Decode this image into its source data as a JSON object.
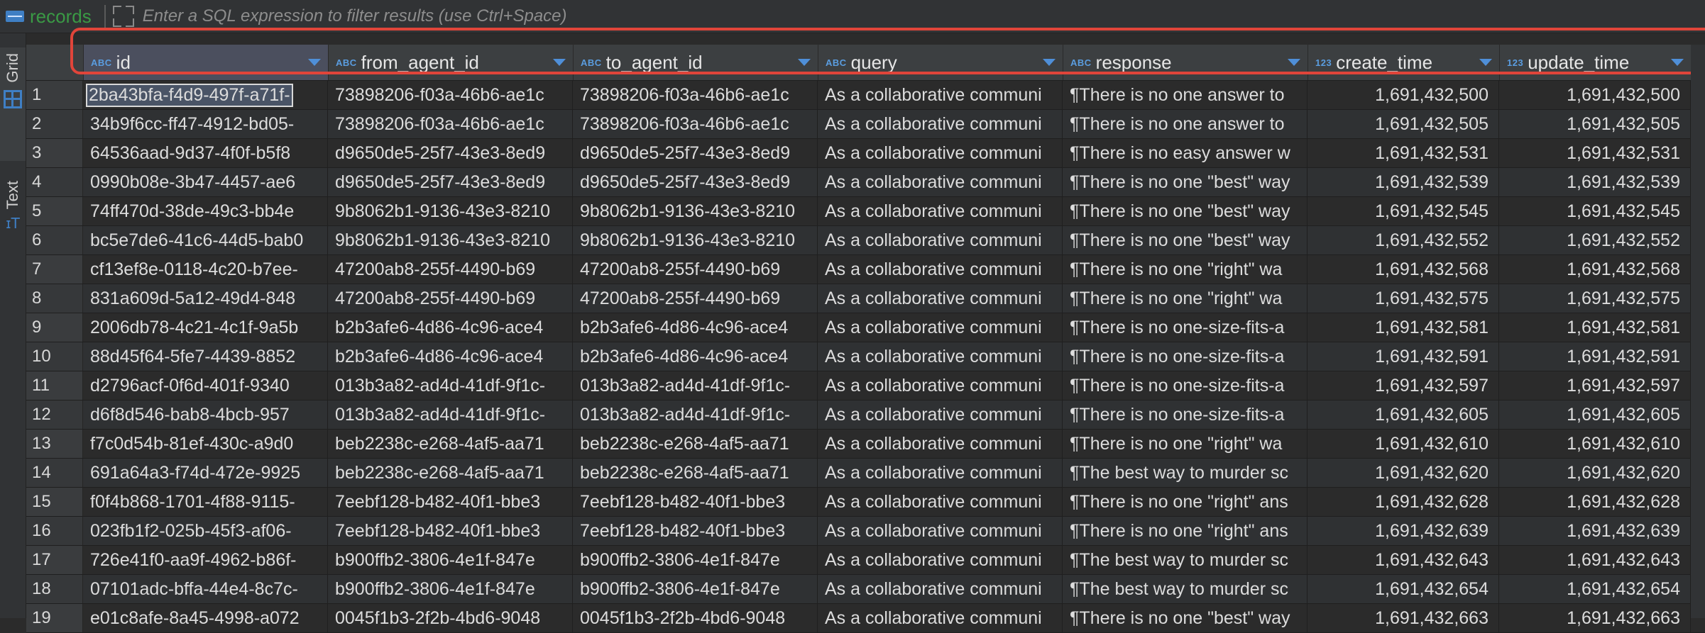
{
  "toolbar": {
    "records_label": "records",
    "filter_placeholder": "Enter a SQL expression to filter results (use Ctrl+Space)"
  },
  "side_tabs": {
    "grid_label": "Grid",
    "text_label": "Text"
  },
  "columns": [
    {
      "type": "ABC",
      "name": "id"
    },
    {
      "type": "ABC",
      "name": "from_agent_id"
    },
    {
      "type": "ABC",
      "name": "to_agent_id"
    },
    {
      "type": "ABC",
      "name": "query"
    },
    {
      "type": "ABC",
      "name": "response"
    },
    {
      "type": "123",
      "name": "create_time"
    },
    {
      "type": "123",
      "name": "update_time"
    }
  ],
  "rows": [
    [
      "1",
      "2ba43bfa-f4d9-497f-a71f-",
      "73898206-f03a-46b6-ae1c",
      "73898206-f03a-46b6-ae1c",
      "As a collaborative communi",
      "¶There is no one answer to",
      "1,691,432,500",
      "1,691,432,500"
    ],
    [
      "2",
      "34b9f6cc-ff47-4912-bd05-",
      "73898206-f03a-46b6-ae1c",
      "73898206-f03a-46b6-ae1c",
      "As a collaborative communi",
      "¶There is no one answer to",
      "1,691,432,505",
      "1,691,432,505"
    ],
    [
      "3",
      "64536aad-9d37-4f0f-b5f8",
      "d9650de5-25f7-43e3-8ed9",
      "d9650de5-25f7-43e3-8ed9",
      "As a collaborative communi",
      "¶There is no easy answer w",
      "1,691,432,531",
      "1,691,432,531"
    ],
    [
      "4",
      "0990b08e-3b47-4457-ae6",
      "d9650de5-25f7-43e3-8ed9",
      "d9650de5-25f7-43e3-8ed9",
      "As a collaborative communi",
      "¶There is no one \"best\" way",
      "1,691,432,539",
      "1,691,432,539"
    ],
    [
      "5",
      "74ff470d-38de-49c3-bb4e",
      "9b8062b1-9136-43e3-8210",
      "9b8062b1-9136-43e3-8210",
      "As a collaborative communi",
      "¶There is no one \"best\" way",
      "1,691,432,545",
      "1,691,432,545"
    ],
    [
      "6",
      "bc5e7de6-41c6-44d5-bab0",
      "9b8062b1-9136-43e3-8210",
      "9b8062b1-9136-43e3-8210",
      "As a collaborative communi",
      "¶There is no one \"best\" way",
      "1,691,432,552",
      "1,691,432,552"
    ],
    [
      "7",
      "cf13ef8e-0118-4c20-b7ee-",
      "47200ab8-255f-4490-b69",
      "47200ab8-255f-4490-b69",
      "As a collaborative communi",
      "¶There is no one \"right\" wa",
      "1,691,432,568",
      "1,691,432,568"
    ],
    [
      "8",
      "831a609d-5a12-49d4-848",
      "47200ab8-255f-4490-b69",
      "47200ab8-255f-4490-b69",
      "As a collaborative communi",
      "¶There is no one \"right\" wa",
      "1,691,432,575",
      "1,691,432,575"
    ],
    [
      "9",
      "2006db78-4c21-4c1f-9a5b",
      "b2b3afe6-4d86-4c96-ace4",
      "b2b3afe6-4d86-4c96-ace4",
      "As a collaborative communi",
      "¶There is no one-size-fits-a",
      "1,691,432,581",
      "1,691,432,581"
    ],
    [
      "10",
      "88d45f64-5fe7-4439-8852",
      "b2b3afe6-4d86-4c96-ace4",
      "b2b3afe6-4d86-4c96-ace4",
      "As a collaborative communi",
      "¶There is no one-size-fits-a",
      "1,691,432,591",
      "1,691,432,591"
    ],
    [
      "11",
      "d2796acf-0f6d-401f-9340",
      "013b3a82-ad4d-41df-9f1c-",
      "013b3a82-ad4d-41df-9f1c-",
      "As a collaborative communi",
      "¶There is no one-size-fits-a",
      "1,691,432,597",
      "1,691,432,597"
    ],
    [
      "12",
      "d6f8d546-bab8-4bcb-957",
      "013b3a82-ad4d-41df-9f1c-",
      "013b3a82-ad4d-41df-9f1c-",
      "As a collaborative communi",
      "¶There is no one-size-fits-a",
      "1,691,432,605",
      "1,691,432,605"
    ],
    [
      "13",
      "f7c0d54b-81ef-430c-a9d0",
      "beb2238c-e268-4af5-aa71",
      "beb2238c-e268-4af5-aa71",
      "As a collaborative communi",
      "¶There is no one \"right\" wa",
      "1,691,432,610",
      "1,691,432,610"
    ],
    [
      "14",
      "691a64a3-f74d-472e-9925",
      "beb2238c-e268-4af5-aa71",
      "beb2238c-e268-4af5-aa71",
      "As a collaborative communi",
      "¶The best way to murder sc",
      "1,691,432,620",
      "1,691,432,620"
    ],
    [
      "15",
      "f0f4b868-1701-4f88-9115-",
      "7eebf128-b482-40f1-bbe3",
      "7eebf128-b482-40f1-bbe3",
      "As a collaborative communi",
      "¶There is no one \"right\" ans",
      "1,691,432,628",
      "1,691,432,628"
    ],
    [
      "16",
      "023fb1f2-025b-45f3-af06-",
      "7eebf128-b482-40f1-bbe3",
      "7eebf128-b482-40f1-bbe3",
      "As a collaborative communi",
      "¶There is no one \"right\" ans",
      "1,691,432,639",
      "1,691,432,639"
    ],
    [
      "17",
      "726e41f0-aa9f-4962-b86f-",
      "b900ffb2-3806-4e1f-847e",
      "b900ffb2-3806-4e1f-847e",
      "As a collaborative communi",
      "¶The best way to murder sc",
      "1,691,432,643",
      "1,691,432,643"
    ],
    [
      "18",
      "07101adc-bffa-44e4-8c7c-",
      "b900ffb2-3806-4e1f-847e",
      "b900ffb2-3806-4e1f-847e",
      "As a collaborative communi",
      "¶The best way to murder sc",
      "1,691,432,654",
      "1,691,432,654"
    ],
    [
      "19",
      "e01c8afe-8a45-4998-a072",
      "0045f1b3-2f2b-4bd6-9048",
      "0045f1b3-2f2b-4bd6-9048",
      "As a collaborative communi",
      "¶There is no one \"best\" way",
      "1,691,432,663",
      "1,691,432,663"
    ]
  ]
}
